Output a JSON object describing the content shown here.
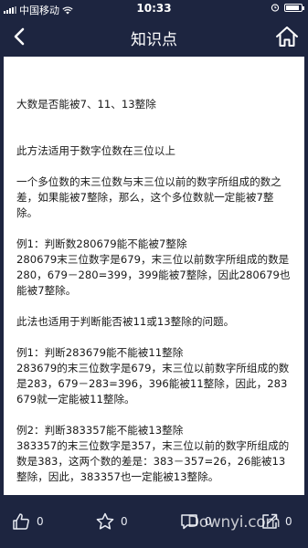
{
  "status_bar": {
    "carrier": "中国移动",
    "time": "10:33"
  },
  "nav": {
    "title": "知识点"
  },
  "article": {
    "paragraphs": [
      "大数是否能被7、11、13整除",
      "",
      "",
      "此方法适用于数字位数在三位以上",
      "",
      "一个多位数的末三位数与末三位以前的数字所组成的数之差，如果能被7整除，那么，这个多位数就一定能被7整除。",
      "",
      "例1：判断数280679能不能被7整除",
      "280679末三位数字是679，末三位以前数字所组成的数是280，679－280=399，399能被7整除，因此280679也能被7整除。",
      "",
      "此法也适用于判断能否被11或13整除的问题。",
      "",
      "例1：判断283679能不能被11整除",
      "283679的末三位数字是679，末三位以前数字所组成的数是283，679－283=396，396能被11整除，因此，283679就一定能被11整除。",
      "",
      "例2：判断383357能不能被13整除",
      "383357的末三位数字是357，末三位以前的数字所组成的数是383，这两个数的差是：383－357=26，26能被13整除，因此，383357也一定能被13整除。"
    ]
  },
  "bottom_bar": {
    "like_count": "0",
    "favorite_count": "0",
    "comment_count": "0",
    "share_count": "0"
  },
  "watermark": {
    "text": "Downyi.com"
  }
}
